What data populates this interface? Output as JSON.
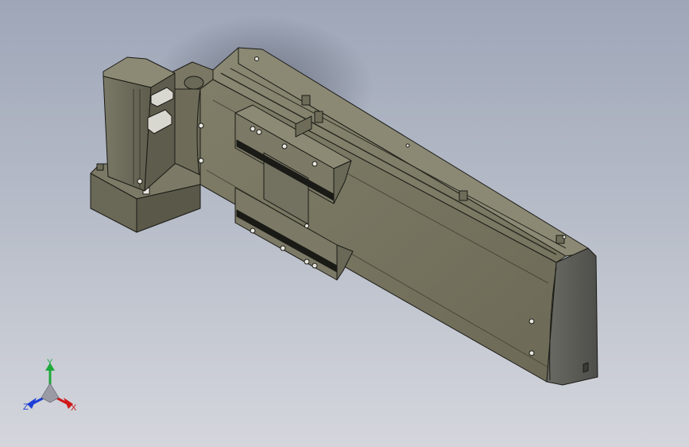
{
  "viewport": {
    "name": "cad-3d-viewport",
    "model": "linear-actuator-module"
  },
  "triad": {
    "x_label": "X",
    "y_label": "Y",
    "z_label": "Z",
    "x_color": "#d01818",
    "y_color": "#1fa83a",
    "z_color": "#1c3fd6"
  },
  "colors": {
    "body_top": "#7e7c66",
    "body_front": "#6e6c58",
    "body_side": "#5a5848",
    "edge": "#1a1a16",
    "background_top": "#9ea6b8",
    "background_bottom": "#d4d6dc"
  }
}
